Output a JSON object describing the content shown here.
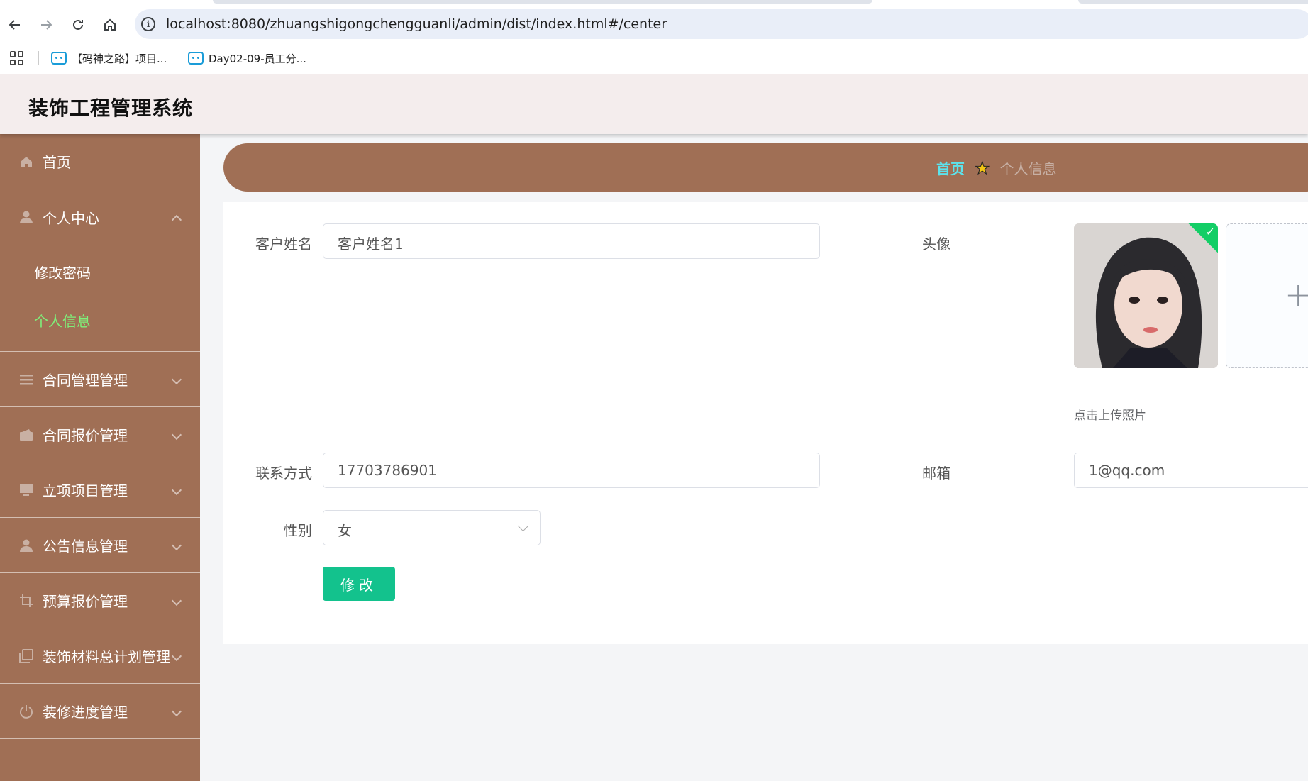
{
  "browser": {
    "url": "localhost:8080/zhuangshigongchengguanli/admin/dist/index.html#/center",
    "bookmarks": [
      "【码神之路】项目...",
      "Day02-09-员工分..."
    ]
  },
  "app": {
    "title": "装饰工程管理系统"
  },
  "sidebar": {
    "home": "首页",
    "personal_center": "个人中心",
    "sub_items": [
      "修改密码",
      "个人信息"
    ],
    "items": [
      "合同管理管理",
      "合同报价管理",
      "立项项目管理",
      "公告信息管理",
      "预算报价管理",
      "装饰材料总计划管理",
      "装修进度管理"
    ]
  },
  "breadcrumb": {
    "home": "首页",
    "current": "个人信息"
  },
  "form": {
    "name_label": "客户姓名",
    "name_value": "客户姓名1",
    "avatar_label": "头像",
    "upload_tip": "点击上传照片",
    "phone_label": "联系方式",
    "phone_value": "17703786901",
    "email_label": "邮箱",
    "email_value": "1@qq.com",
    "gender_label": "性别",
    "gender_value": "女",
    "submit_label": "修改"
  },
  "colors": {
    "sidebar": "#a06f55",
    "active": "#7ff07a",
    "button": "#13c28d",
    "crumb_home": "#5ce3ec"
  }
}
